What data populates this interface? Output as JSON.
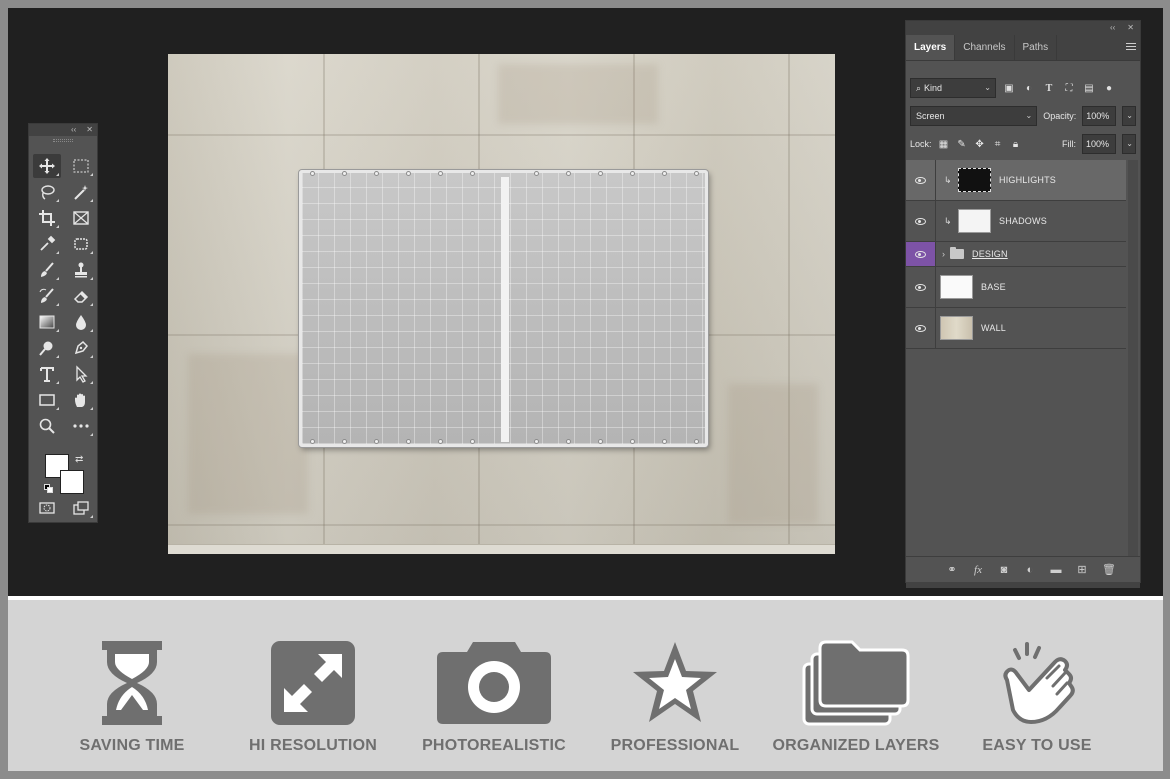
{
  "layers_panel": {
    "tabs": [
      {
        "label": "Layers",
        "active": true
      },
      {
        "label": "Channels",
        "active": false
      },
      {
        "label": "Paths",
        "active": false
      }
    ],
    "filter_kind": "Kind",
    "blend_mode": "Screen",
    "opacity_label": "Opacity:",
    "opacity_value": "100%",
    "lock_label": "Lock:",
    "fill_label": "Fill:",
    "fill_value": "100%",
    "layers": [
      {
        "name": "HIGHLIGHTS",
        "selected": true
      },
      {
        "name": "SHADOWS",
        "selected": false
      },
      {
        "name": "DESIGN",
        "selected": false
      },
      {
        "name": "BASE",
        "selected": false
      },
      {
        "name": "WALL",
        "selected": false
      }
    ]
  },
  "features": [
    {
      "label": "SAVING TIME",
      "icon": "hourglass-icon"
    },
    {
      "label": "HI RESOLUTION",
      "icon": "expand-icon"
    },
    {
      "label": "PHOTOREALISTIC",
      "icon": "camera-icon"
    },
    {
      "label": "PROFESSIONAL",
      "icon": "star-icon"
    },
    {
      "label": "ORGANIZED LAYERS",
      "icon": "folders-icon"
    },
    {
      "label": "EASY TO USE",
      "icon": "pointing-hand-icon"
    }
  ],
  "colors": {
    "workspace": "#202020",
    "panel": "#535353",
    "feature_strip": "#d4d4d4",
    "feature_icon": "#6f6f6f",
    "design_eye_highlight": "#7d53a6"
  }
}
